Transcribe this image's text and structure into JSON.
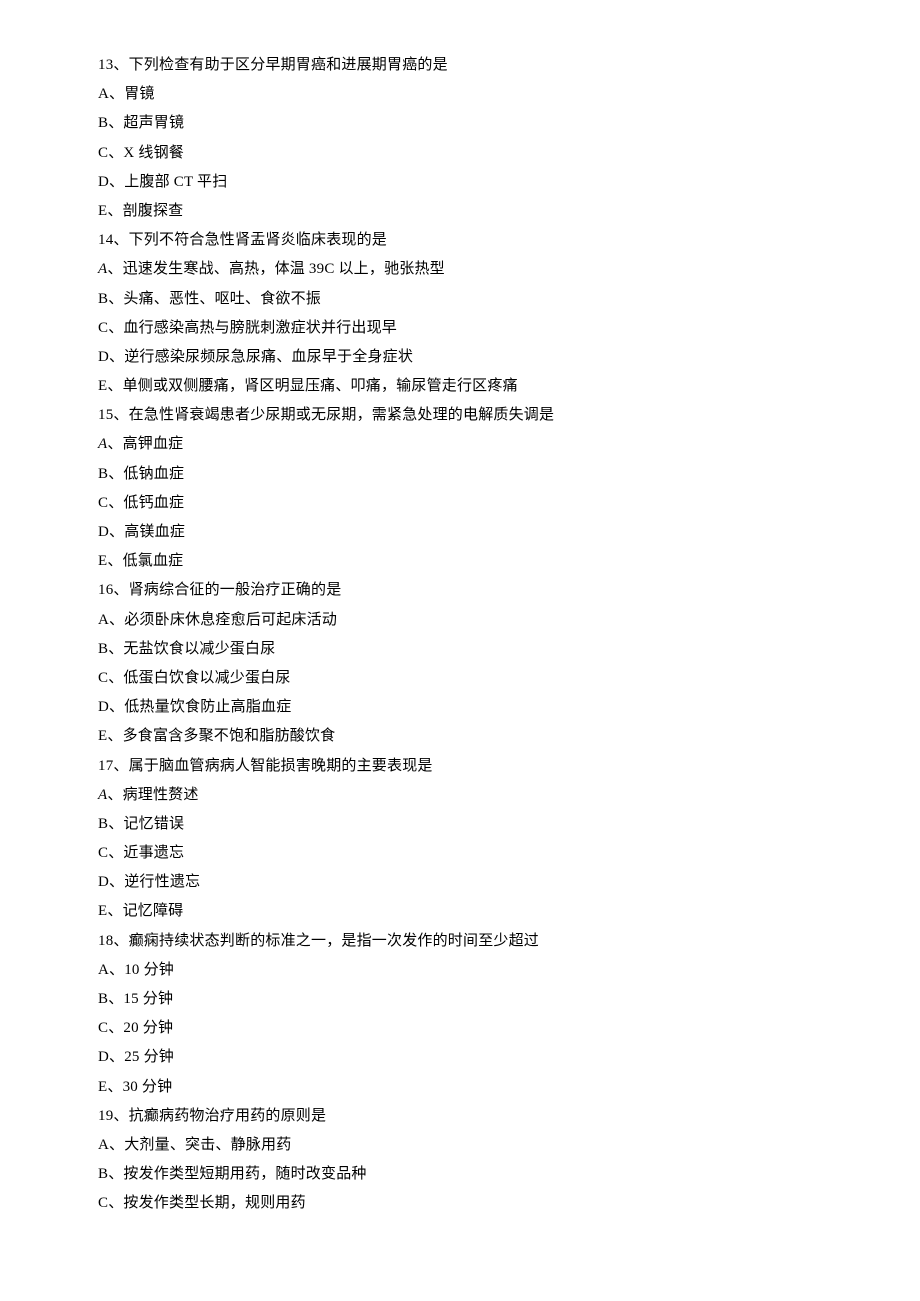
{
  "questions": [
    {
      "stem": "13、下列检查有助于区分早期胃癌和进展期胃癌的是",
      "options": [
        "A、胃镜",
        "B、超声胃镜",
        "C、X 线钢餐",
        "D、上腹部 CT 平扫",
        "E、剖腹探查"
      ]
    },
    {
      "stem": "14、下列不符合急性肾盂肾炎临床表现的是",
      "options": [
        "A、迅速发生寒战、高热，体温 39C 以上，驰张热型",
        "B、头痛、恶性、呕吐、食欲不振",
        "C、血行感染高热与膀胱刺激症状并行出现早",
        "D、逆行感染尿频尿急尿痛、血尿早于全身症状",
        "E、单侧或双侧腰痛，肾区明显压痛、叩痛，输尿管走行区疼痛"
      ],
      "italicFirst": true
    },
    {
      "stem": "15、在急性肾衰竭患者少尿期或无尿期，需紧急处理的电解质失调是",
      "options": [
        "A、高钾血症",
        "B、低钠血症",
        "C、低钙血症",
        "D、高镁血症",
        "E、低氯血症"
      ],
      "italicFirst": true
    },
    {
      "stem": "16、肾病综合征的一般治疗正确的是",
      "options": [
        "A、必须卧床休息痊愈后可起床活动",
        "B、无盐饮食以减少蛋白尿",
        "C、低蛋白饮食以减少蛋白尿",
        "D、低热量饮食防止高脂血症",
        "E、多食富含多聚不饱和脂肪酸饮食"
      ]
    },
    {
      "stem": "17、属于脑血管病病人智能损害晚期的主要表现是",
      "options": [
        "A、病理性赘述",
        "B、记忆错误",
        "C、近事遗忘",
        "D、逆行性遗忘",
        "E、记忆障碍"
      ],
      "italicFirst": true
    },
    {
      "stem": "18、癫痫持续状态判断的标准之一，是指一次发作的时间至少超过",
      "options": [
        "A、10 分钟",
        "B、15 分钟",
        "C、20 分钟",
        "D、25 分钟",
        "E、30 分钟"
      ]
    },
    {
      "stem": "19、抗癫病药物治疗用药的原则是",
      "options": [
        "A、大剂量、突击、静脉用药",
        "B、按发作类型短期用药，随时改变品种",
        "C、按发作类型长期，规则用药"
      ]
    }
  ]
}
